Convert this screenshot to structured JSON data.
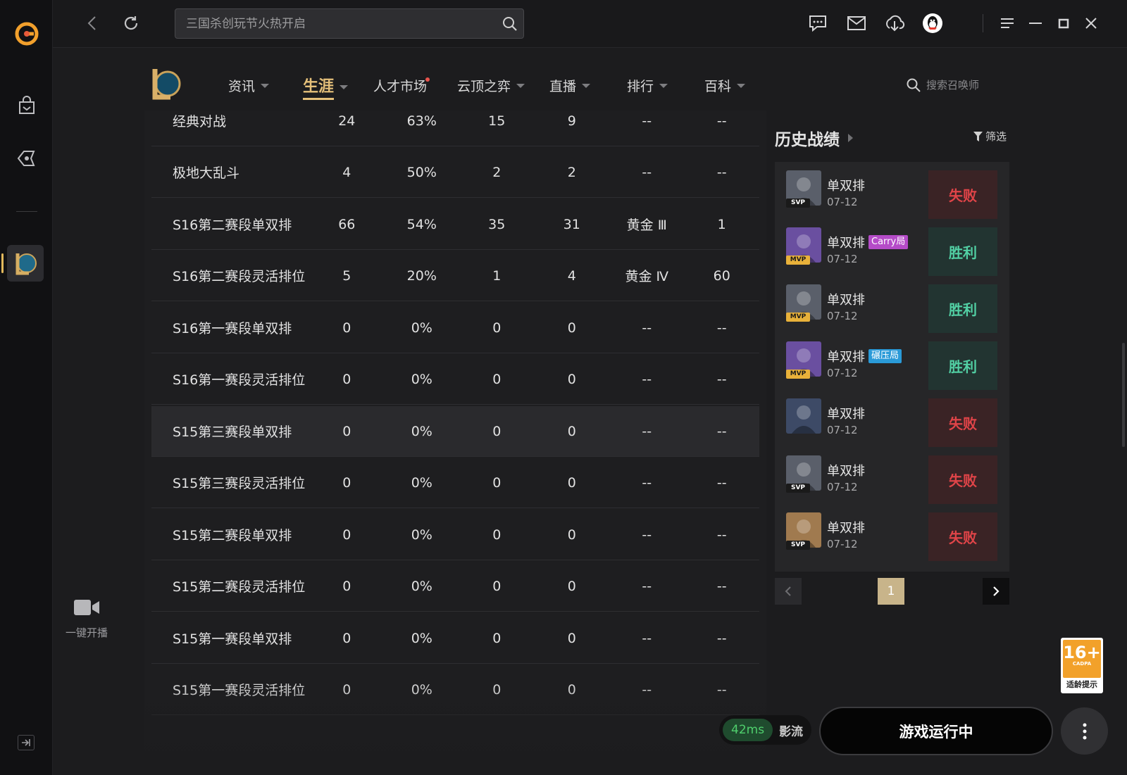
{
  "search": {
    "placeholder": "三国杀创玩节火热开启"
  },
  "live": {
    "label": "一键开播"
  },
  "menu": [
    {
      "label": "资讯",
      "active": false
    },
    {
      "label": "生涯",
      "active": true
    },
    {
      "label": "人才市场",
      "active": false,
      "dot": true
    },
    {
      "label": "云顶之弈",
      "active": false
    },
    {
      "label": "直播",
      "active": false
    },
    {
      "label": "排行",
      "active": false
    },
    {
      "label": "百科",
      "active": false
    }
  ],
  "summoner_search": {
    "placeholder": "搜索召唤师"
  },
  "stats_rows": [
    [
      "经典对战",
      "24",
      "63%",
      "15",
      "9",
      "--",
      "--"
    ],
    [
      "极地大乱斗",
      "4",
      "50%",
      "2",
      "2",
      "--",
      "--"
    ],
    [
      "S16第二赛段单双排",
      "66",
      "54%",
      "35",
      "31",
      "黄金 Ⅲ",
      "1"
    ],
    [
      "S16第二赛段灵活排位",
      "5",
      "20%",
      "1",
      "4",
      "黄金 Ⅳ",
      "60"
    ],
    [
      "S16第一赛段单双排",
      "0",
      "0%",
      "0",
      "0",
      "--",
      "--"
    ],
    [
      "S16第一赛段灵活排位",
      "0",
      "0%",
      "0",
      "0",
      "--",
      "--"
    ],
    [
      "S15第三赛段单双排",
      "0",
      "0%",
      "0",
      "0",
      "--",
      "--"
    ],
    [
      "S15第三赛段灵活排位",
      "0",
      "0%",
      "0",
      "0",
      "--",
      "--"
    ],
    [
      "S15第二赛段单双排",
      "0",
      "0%",
      "0",
      "0",
      "--",
      "--"
    ],
    [
      "S15第二赛段灵活排位",
      "0",
      "0%",
      "0",
      "0",
      "--",
      "--"
    ],
    [
      "S15第一赛段单双排",
      "0",
      "0%",
      "0",
      "0",
      "--",
      "--"
    ],
    [
      "S15第一赛段灵活排位",
      "0",
      "0%",
      "0",
      "0",
      "--",
      "--"
    ]
  ],
  "history": {
    "title": "历史战绩",
    "filter": "筛选",
    "matches": [
      {
        "mode": "单双排",
        "date": "07-12",
        "result": "失败",
        "outcome": "loss",
        "badge": "SVP",
        "tag": "",
        "color": "#5a5f6a"
      },
      {
        "mode": "单双排",
        "date": "07-12",
        "result": "胜利",
        "outcome": "win",
        "badge": "MVP",
        "tag": "Carry局",
        "tag_type": "carry",
        "color": "#6a4fa0"
      },
      {
        "mode": "单双排",
        "date": "07-12",
        "result": "胜利",
        "outcome": "win",
        "badge": "MVP",
        "tag": "",
        "color": "#5a5f6a"
      },
      {
        "mode": "单双排",
        "date": "07-12",
        "result": "胜利",
        "outcome": "win",
        "badge": "MVP",
        "tag": "碾压局",
        "tag_type": "crush",
        "color": "#6a4fa0"
      },
      {
        "mode": "单双排",
        "date": "07-12",
        "result": "失败",
        "outcome": "loss",
        "badge": "",
        "tag": "",
        "color": "#3d4a66"
      },
      {
        "mode": "单双排",
        "date": "07-12",
        "result": "失败",
        "outcome": "loss",
        "badge": "SVP",
        "tag": "",
        "color": "#5a5f6a"
      },
      {
        "mode": "单双排",
        "date": "07-12",
        "result": "失败",
        "outcome": "loss",
        "badge": "SVP",
        "tag": "",
        "color": "#a07a4f"
      }
    ],
    "page": "1"
  },
  "ping": {
    "value": "42ms",
    "name": "影流"
  },
  "run_button": "游戏运行中",
  "age_rating": {
    "number": "16+",
    "org": "CADPA",
    "label": "适龄提示"
  },
  "colors": {
    "accent": "#e5c07a",
    "win": "#52d0a4",
    "loss": "#e04448"
  }
}
